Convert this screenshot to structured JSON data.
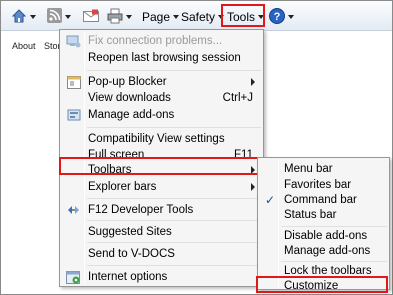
{
  "toolbar": {
    "page_label": "Page",
    "safety_label": "Safety",
    "tools_label": "Tools"
  },
  "page_links": [
    "About",
    "Store"
  ],
  "menu": {
    "items": [
      {
        "label": "Fix connection problems...",
        "icon": "network-diagnose-icon",
        "disabled": true
      },
      {
        "label": "Reopen last browsing session",
        "icon": "",
        "disabled": false
      },
      {
        "label": "Pop-up Blocker",
        "icon": "popup-blocker-icon",
        "submenu": true
      },
      {
        "label": "View downloads",
        "accel": "Ctrl+J"
      },
      {
        "label": "Manage add-ons",
        "icon": "addons-icon"
      },
      {
        "label": "Compatibility View settings"
      },
      {
        "label": "Full screen",
        "accel": "F11"
      },
      {
        "label": "Toolbars",
        "submenu": true
      },
      {
        "label": "Explorer bars",
        "submenu": true
      },
      {
        "label": "F12 Developer Tools",
        "icon": "developer-tools-icon"
      },
      {
        "label": "Suggested Sites"
      },
      {
        "label": "Send to V-DOCS"
      },
      {
        "label": "Internet options",
        "icon": "internet-options-icon"
      }
    ]
  },
  "submenu": {
    "items": [
      {
        "label": "Menu bar",
        "checked": false
      },
      {
        "label": "Favorites bar",
        "checked": false
      },
      {
        "label": "Command bar",
        "checked": true
      },
      {
        "label": "Status bar",
        "checked": false
      },
      {
        "label": "Disable add-ons",
        "checked": false
      },
      {
        "label": "Manage add-ons",
        "checked": false
      },
      {
        "label": "Lock the toolbars",
        "checked": false
      },
      {
        "label": "Customize",
        "checked": false
      }
    ]
  },
  "colors": {
    "highlight_border": "#e01818",
    "menu_bg": "#f5f5f5",
    "check_color": "#1b4fa0"
  }
}
